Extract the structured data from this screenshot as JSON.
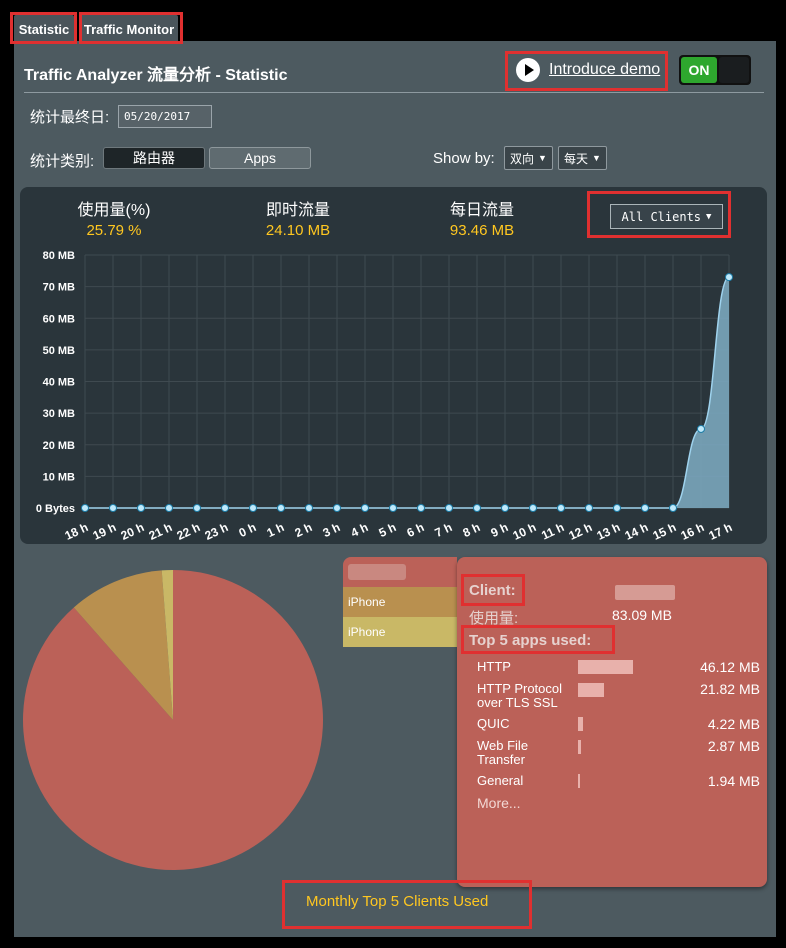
{
  "tabs": [
    {
      "label": "Statistic"
    },
    {
      "label": "Traffic Monitor"
    }
  ],
  "header": {
    "title": "Traffic Analyzer 流量分析 - Statistic",
    "demo_link": "Introduce demo",
    "toggle": "ON"
  },
  "date": {
    "label": "统计最终日:",
    "value": "05/20/2017"
  },
  "category": {
    "label": "统计类别:",
    "options": [
      "路由器",
      "Apps"
    ]
  },
  "showby": {
    "label": "Show by:",
    "direction": "双向",
    "period": "每天"
  },
  "stats": {
    "usage_label": "使用量(%)",
    "usage_value": "25.79 %",
    "realtime_label": "即时流量",
    "realtime_value": "24.10 MB",
    "daily_label": "每日流量",
    "daily_value": "93.46 MB"
  },
  "client_select": "All Clients",
  "chart_data": {
    "type": "area",
    "x": [
      "18 h",
      "19 h",
      "20 h",
      "21 h",
      "22 h",
      "23 h",
      "0 h",
      "1 h",
      "2 h",
      "3 h",
      "4 h",
      "5 h",
      "6 h",
      "7 h",
      "8 h",
      "9 h",
      "10 h",
      "11 h",
      "12 h",
      "13 h",
      "14 h",
      "15 h",
      "16 h",
      "17 h"
    ],
    "values": [
      0,
      0,
      0,
      0,
      0,
      0,
      0,
      0,
      0,
      0,
      0,
      0,
      0,
      0,
      0,
      0,
      0,
      0,
      0,
      0,
      0,
      0,
      25,
      73
    ],
    "y_tick_labels": [
      "0 Bytes",
      "10 MB",
      "20 MB",
      "30 MB",
      "40 MB",
      "50 MB",
      "60 MB",
      "70 MB",
      "80 MB"
    ],
    "ylim": [
      0,
      80
    ],
    "grid": true
  },
  "pie": {
    "type": "pie",
    "values": [
      88.5,
      10.3,
      1.2
    ],
    "colors": [
      "#bb6158",
      "#b9904f",
      "#c9b866"
    ],
    "legend": [
      {
        "label": "",
        "color": "#bb6158"
      },
      {
        "label": "iPhone",
        "color": "#b9904f"
      },
      {
        "label": "iPhone",
        "color": "#c9b866"
      }
    ]
  },
  "info": {
    "client_label": "Client:",
    "usage_label": "使用量:",
    "usage_value": "83.09 MB",
    "top_label": "Top 5 apps used:",
    "apps": [
      {
        "name": "HTTP",
        "value": "46.12 MB",
        "share": 1.0
      },
      {
        "name": "HTTP Protocol over TLS SSL",
        "value": "21.82 MB",
        "share": 0.47
      },
      {
        "name": "QUIC",
        "value": "4.22 MB",
        "share": 0.09
      },
      {
        "name": "Web File Transfer",
        "value": "2.87 MB",
        "share": 0.06
      },
      {
        "name": "General",
        "value": "1.94 MB",
        "share": 0.04
      }
    ],
    "more": "More..."
  },
  "footer": {
    "monthly": "Monthly Top 5 Clients Used"
  },
  "colors": {
    "accent_yellow": "#ffc720",
    "toggle_green": "#2ea72e",
    "area_fill": "#7aa6bd",
    "info_bg": "#bb6158"
  }
}
